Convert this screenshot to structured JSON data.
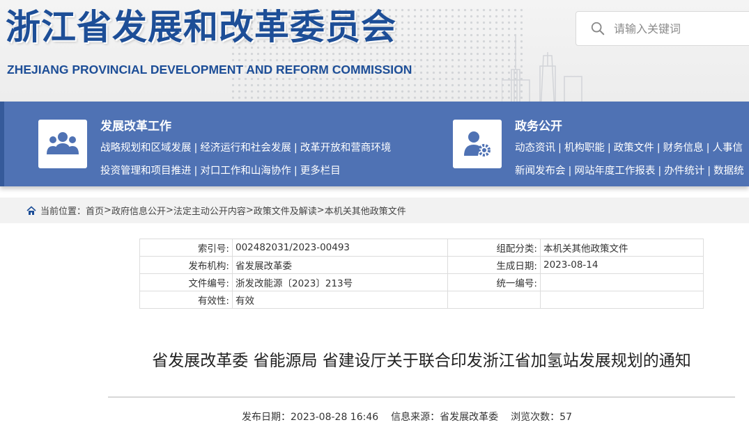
{
  "header": {
    "title": "浙江省发展和改革委员会",
    "subtitle": "ZHEJIANG PROVINCIAL DEVELOPMENT AND REFORM COMMISSION",
    "search_placeholder": "请输入关键词"
  },
  "nav": {
    "sections": [
      {
        "icon": "people-icon",
        "title": "发展改革工作",
        "row1": [
          "战略规划和区域发展",
          "经济运行和社会发展",
          "改革开放和营商环境"
        ],
        "row2": [
          "投资管理和项目推进",
          "对口工作和山海协作",
          "更多栏目"
        ]
      },
      {
        "icon": "user-gear-icon",
        "title": "政务公开",
        "row1": [
          "动态资讯",
          "机构职能",
          "政策文件",
          "财务信息",
          "人事信"
        ],
        "row2": [
          "新闻发布会",
          "网站年度工作报表",
          "办件统计",
          "数据统"
        ]
      }
    ]
  },
  "breadcrumb": {
    "label": "当前位置：",
    "items": [
      "首页",
      "政府信息公开",
      "法定主动公开内容",
      "政策文件及解读",
      "本机关其他政策文件"
    ]
  },
  "meta": {
    "index_label": "索引号:",
    "index_value": "002482031/2023-00493",
    "category_label": "组配分类:",
    "category_value": "本机关其他政策文件",
    "publisher_label": "发布机构:",
    "publisher_value": "省发展改革委",
    "created_label": "生成日期:",
    "created_value": "2023-08-14",
    "docno_label": "文件编号:",
    "docno_value": "浙发改能源〔2023〕213号",
    "unified_label": "统一编号:",
    "unified_value": "",
    "validity_label": "有效性:",
    "validity_value": "有效"
  },
  "article": {
    "title": "省发展改革委 省能源局 省建设厅关于联合印发浙江省加氢站发展规划的通知",
    "publish_label": "发布日期：",
    "publish_value": "2023-08-28 16:46",
    "source_label": "信息来源：",
    "source_value": "省发展改革委",
    "views_label": "浏览次数：",
    "views_value": "57"
  },
  "colors": {
    "brand_blue": "#1d4e97",
    "nav_blue": "#4f72b4"
  }
}
